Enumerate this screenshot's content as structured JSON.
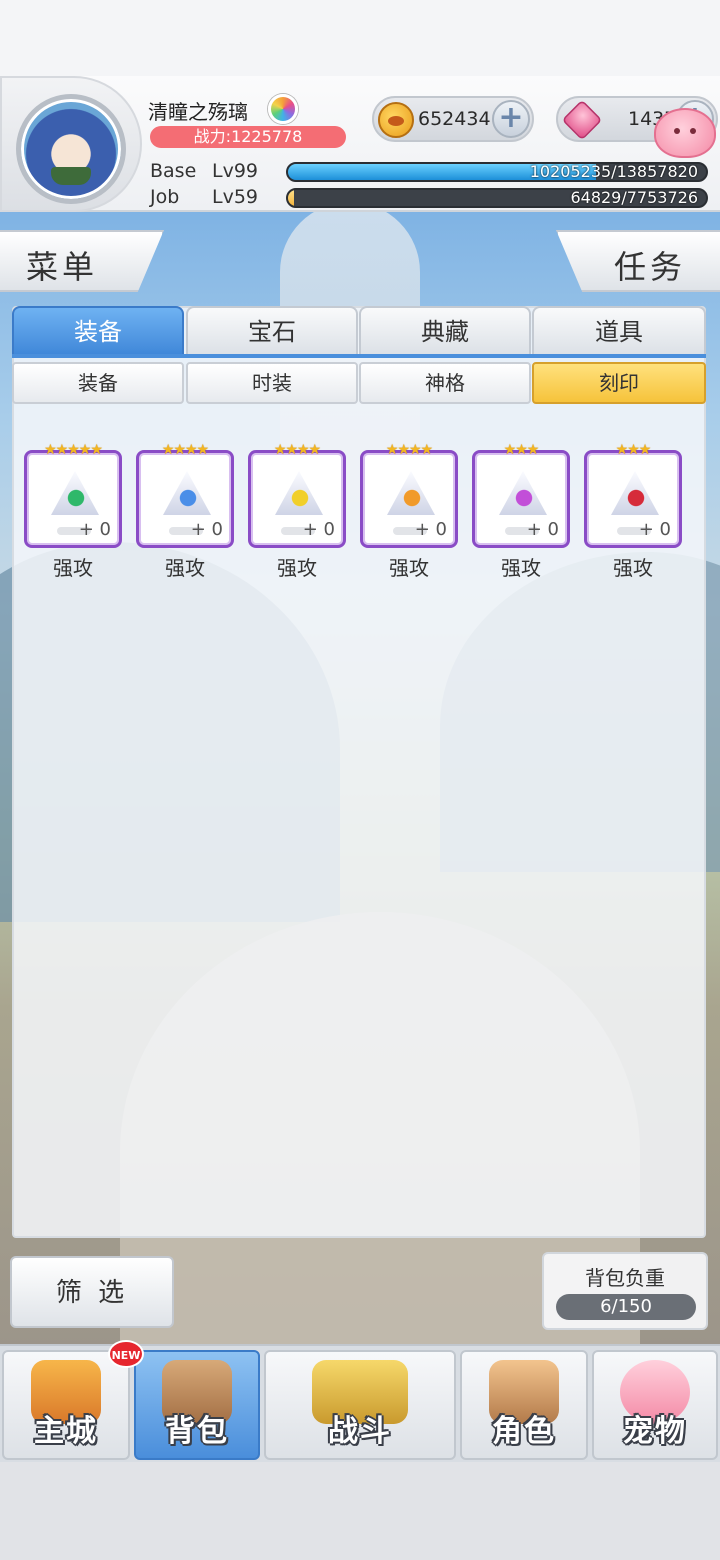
{
  "player": {
    "name": "清瞳之殇璃",
    "power_text": "战力:1225778",
    "base_label": "Base",
    "base_level": "Lv99",
    "base_exp_text": "10205235/13857820",
    "base_exp_fraction": 0.736,
    "job_label": "Job",
    "job_level": "Lv59",
    "job_exp_text": "64829/7753726",
    "job_exp_fraction": 0.008
  },
  "currency": {
    "gold": "652434",
    "gems": "1437"
  },
  "top_buttons": {
    "menu": "菜单",
    "task": "任务"
  },
  "tabs": [
    "装备",
    "宝石",
    "典藏",
    "道具"
  ],
  "subtabs": [
    "装备",
    "时装",
    "神格",
    "刻印"
  ],
  "items": [
    {
      "stars": "★★★★★",
      "plus": "+ 0",
      "name": "强攻",
      "color": "#2fb86a"
    },
    {
      "stars": "★★★★",
      "plus": "+ 0",
      "name": "强攻",
      "color": "#4a8ee8"
    },
    {
      "stars": "★★★★",
      "plus": "+ 0",
      "name": "强攻",
      "color": "#f1cf2a"
    },
    {
      "stars": "★★★★",
      "plus": "+ 0",
      "name": "强攻",
      "color": "#f19a2a"
    },
    {
      "stars": "★★★",
      "plus": "+ 0",
      "name": "强攻",
      "color": "#c24fd8"
    },
    {
      "stars": "★★★",
      "plus": "+ 0",
      "name": "强攻",
      "color": "#d62b3a"
    }
  ],
  "filter_label": "筛 选",
  "bag": {
    "title": "背包负重",
    "value": "6/150"
  },
  "nav": [
    "主城",
    "背包",
    "战斗",
    "角色",
    "宠物"
  ],
  "new_badge": "NEW"
}
